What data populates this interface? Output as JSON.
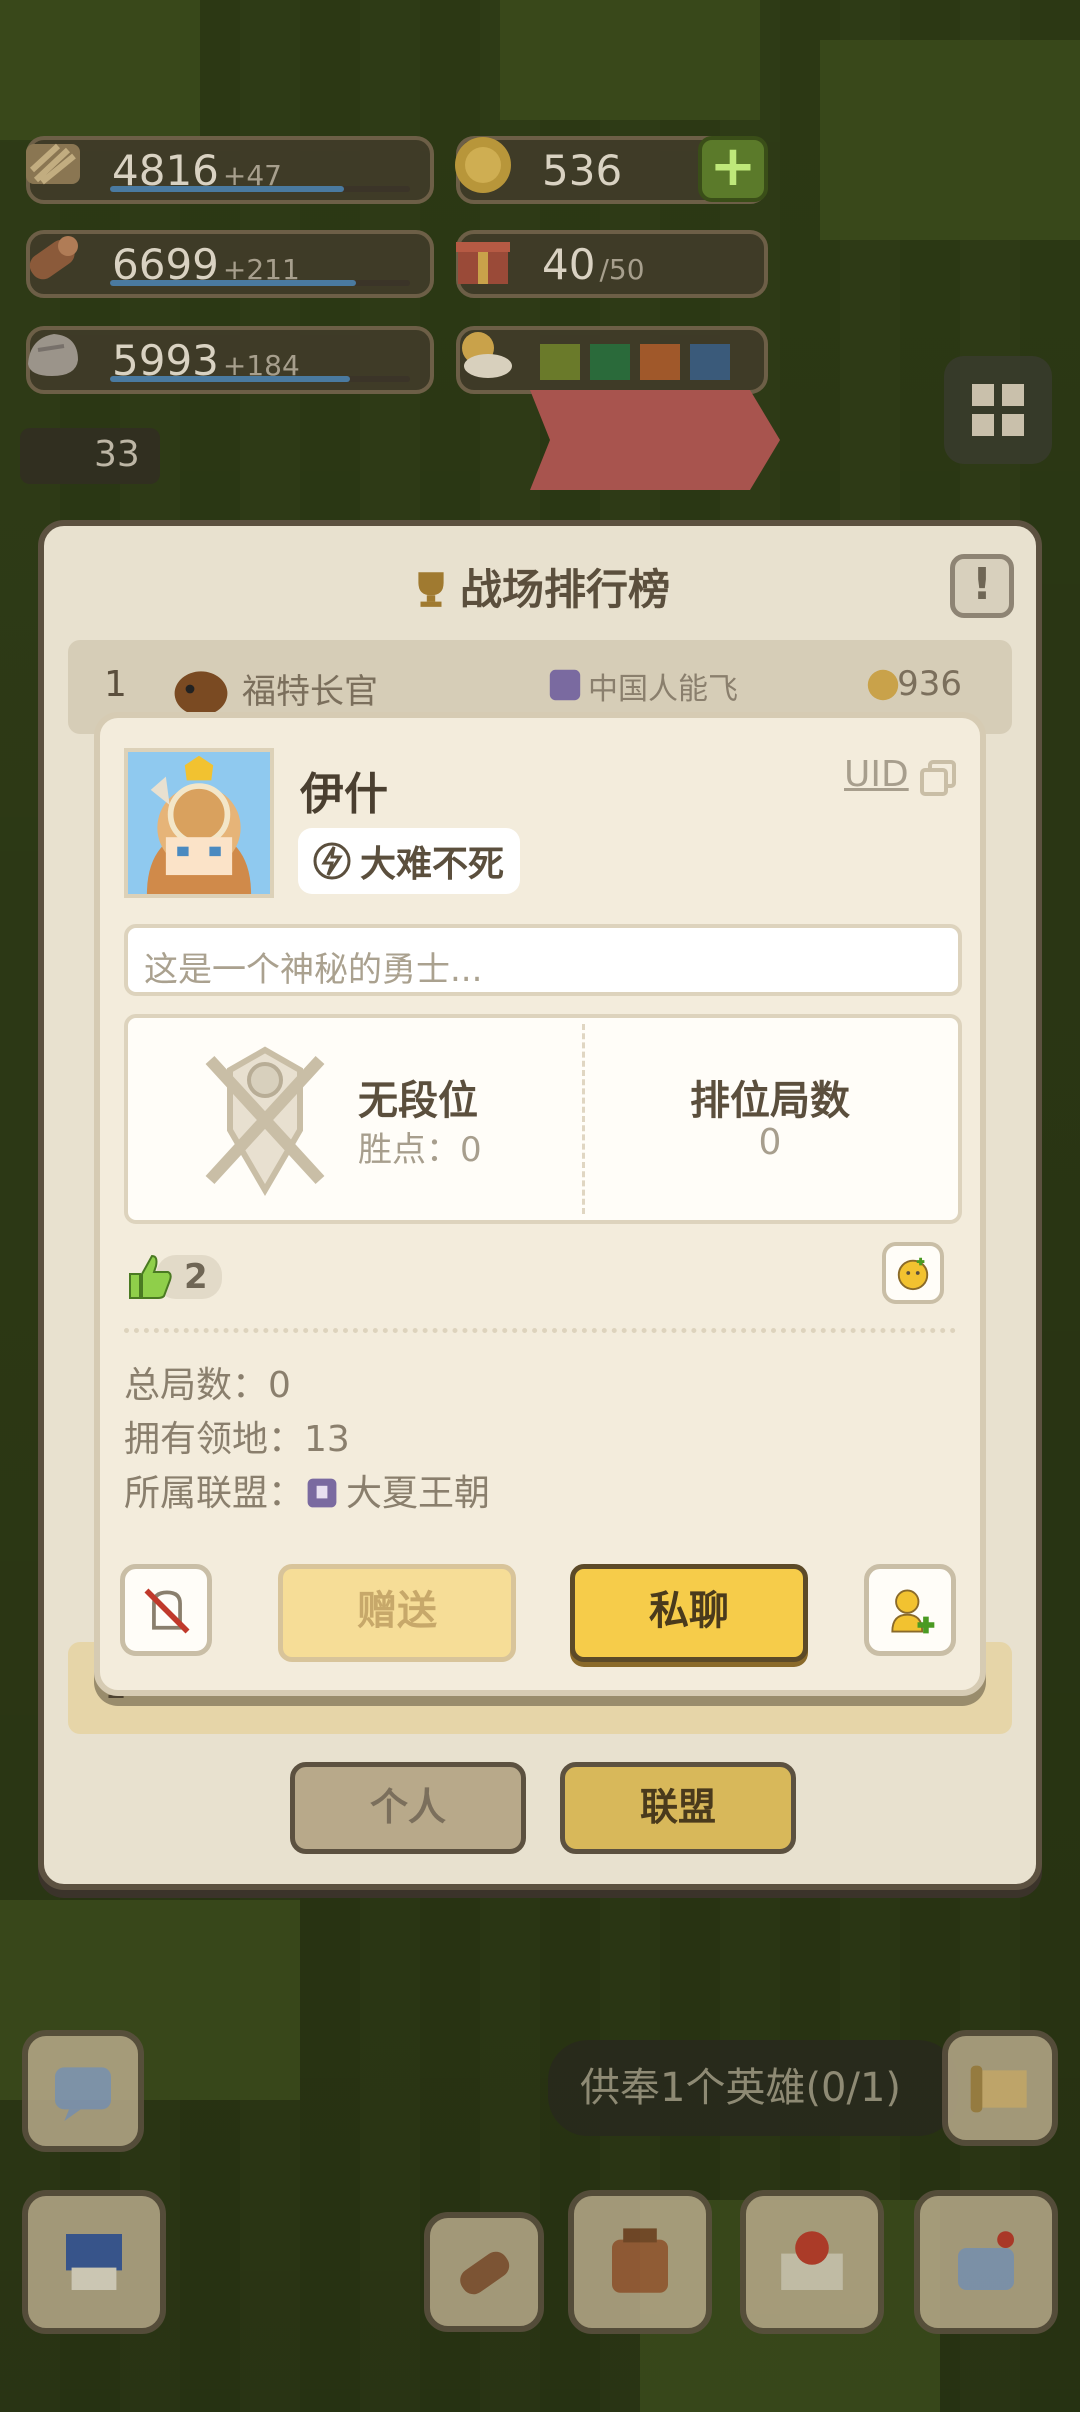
{
  "resources": [
    {
      "value": "4816",
      "increment": "+47",
      "icon": "wheat-icon",
      "fill": 0.78
    },
    {
      "value": "6699",
      "increment": "+211",
      "icon": "wood-log-icon",
      "fill": 0.82
    },
    {
      "value": "5993",
      "increment": "+184",
      "icon": "stone-icon",
      "fill": 0.8
    }
  ],
  "currency": {
    "value": "536",
    "icon": "gold-coin-icon"
  },
  "gifts": {
    "value": "40",
    "max": "/50",
    "icon": "gift-box-icon"
  },
  "ranking": {
    "title": "战场排行榜",
    "row1": {
      "rank": "1",
      "name": "福特长官",
      "alliance": "中国人能飞",
      "score": "936"
    },
    "last_row_rank": "1",
    "tabs": {
      "personal": "个人",
      "alliance": "联盟"
    }
  },
  "profile": {
    "name": "伊什",
    "uid_label": "UID",
    "title": "大难不死",
    "signature_placeholder": "这是一个神秘的勇士...",
    "rank_tier": "无段位",
    "win_points": "胜点：0",
    "ranked_games_label": "排位局数",
    "ranked_games_value": "0",
    "likes": "2",
    "total_games": "总局数：0",
    "territories": "拥有领地：13",
    "alliance_label": "所属联盟：",
    "alliance_name": "大夏王朝",
    "gift_button": "赠送",
    "chat_button": "私聊"
  },
  "side_badge": "33",
  "quest": "供奉1个英雄(0/1)",
  "colors": {
    "accent": "#f6cc4a",
    "panel": "#e8e1cf",
    "card": "#f3ecdc",
    "text": "#5b4f3d"
  }
}
